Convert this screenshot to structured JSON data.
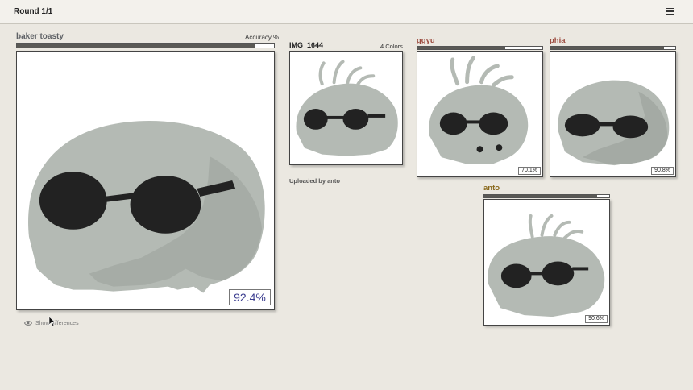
{
  "header": {
    "title": "Round 1/1",
    "menu_icon": "hamburger-menu-icon"
  },
  "main_player": {
    "name": "baker toasty",
    "name_color": "#5f6266",
    "accuracy_label": "Accuracy %",
    "accuracy": 92.4,
    "score_text": "92.4%"
  },
  "reference": {
    "title": "IMG_1644",
    "colors_label": "4 Colors",
    "uploaded_by": "Uploaded by anto"
  },
  "players": [
    {
      "name": "ggyu",
      "name_color": "#9b4a3e",
      "accuracy": 70.1,
      "score_text": "70.1%"
    },
    {
      "name": "phia",
      "name_color": "#9b4a3e",
      "accuracy": 90.8,
      "score_text": "90.8%"
    },
    {
      "name": "anto",
      "name_color": "#8a6a1e",
      "accuracy": 90.6,
      "score_text": "90.6%"
    }
  ],
  "footer": {
    "show_differences_label": "Show differences",
    "eye_icon": "eye-icon"
  },
  "colors": {
    "background": "#ebe8e1",
    "blob": "#b4bab4",
    "blob_shadow": "#a4aaa4",
    "sunglasses": "#222222",
    "score_text": "#3a3c8f"
  }
}
